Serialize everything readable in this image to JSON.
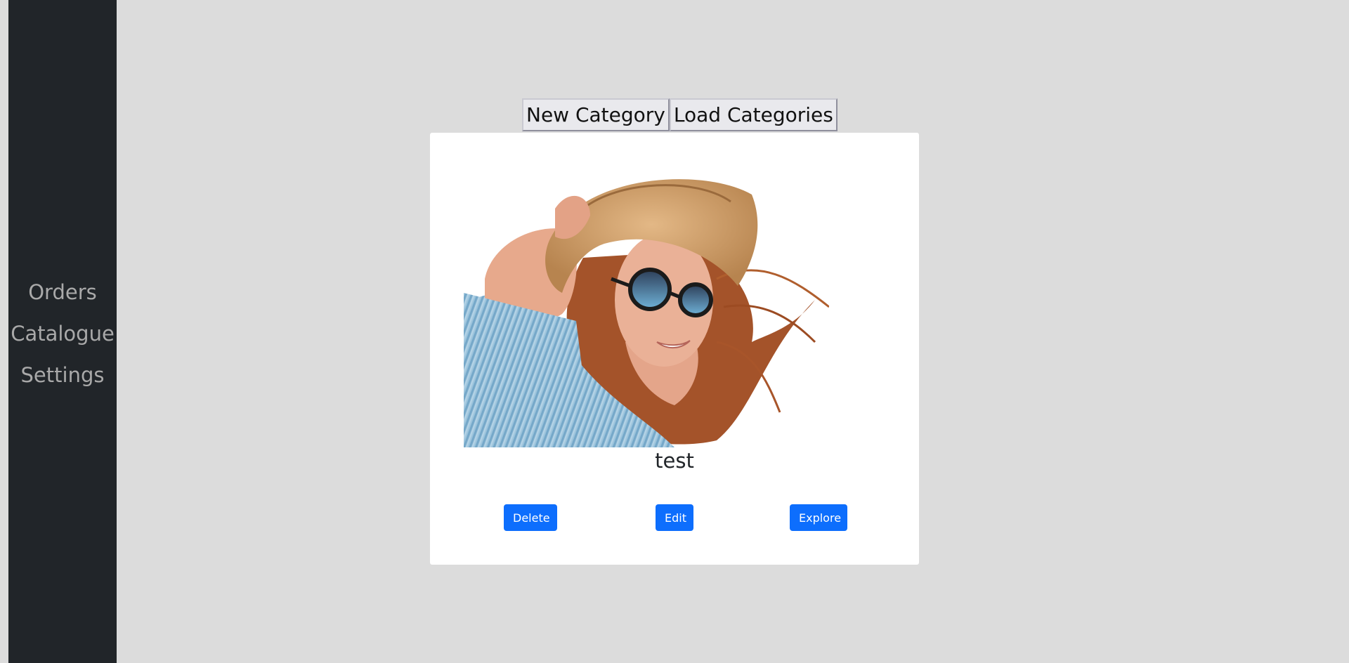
{
  "sidebar": {
    "items": [
      {
        "label": "Orders"
      },
      {
        "label": "Catalogue"
      },
      {
        "label": "Settings"
      }
    ]
  },
  "toolbar": {
    "new_category_label": "New Category",
    "load_categories_label": "Load Categories"
  },
  "category_card": {
    "image_alt": "Woman in straw hat and sunglasses",
    "title": "test",
    "delete_label": "Delete",
    "edit_label": "Edit",
    "explore_label": "Explore"
  },
  "colors": {
    "background": "#dcdcdc",
    "sidebar": "#212529",
    "sidebar_text": "#a9a9a9",
    "primary": "#0d6efd",
    "card": "#ffffff"
  }
}
